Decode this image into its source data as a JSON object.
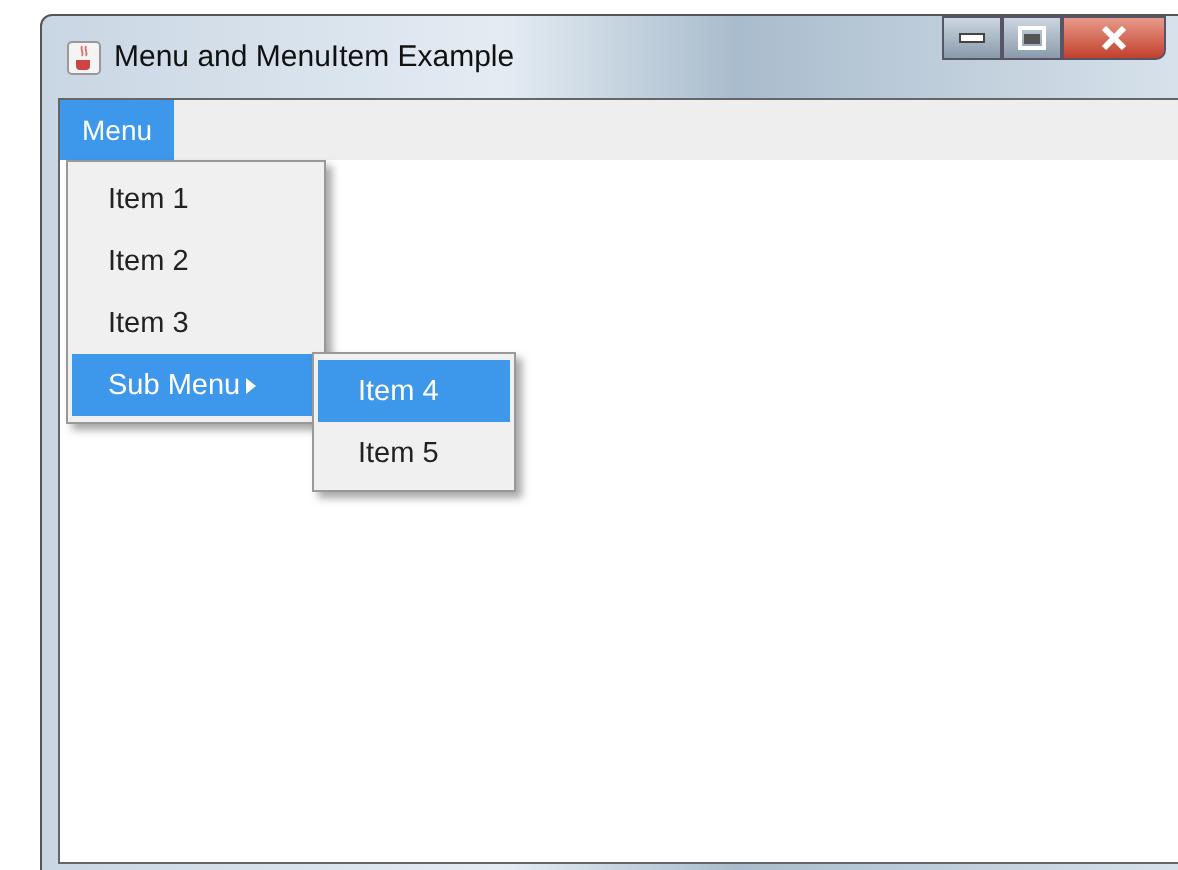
{
  "window": {
    "title": "Menu and MenuItem Example"
  },
  "menubar": [
    {
      "label": "Menu",
      "selected": true
    }
  ],
  "menu": {
    "items": [
      {
        "label": "Item 1",
        "kind": "item",
        "selected": false
      },
      {
        "label": "Item 2",
        "kind": "item",
        "selected": false
      },
      {
        "label": "Item 3",
        "kind": "item",
        "selected": false
      },
      {
        "label": "Sub Menu",
        "kind": "submenu",
        "selected": true
      }
    ]
  },
  "submenu": {
    "items": [
      {
        "label": "Item 4",
        "selected": true
      },
      {
        "label": "Item 5",
        "selected": false
      }
    ]
  }
}
